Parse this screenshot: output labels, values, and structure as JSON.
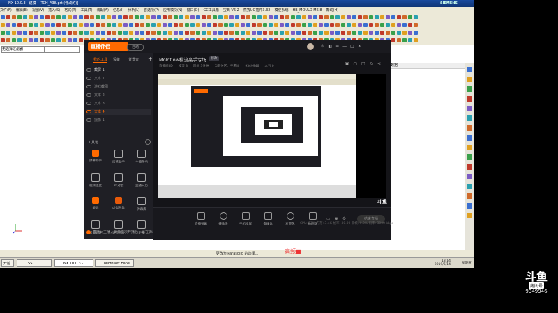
{
  "nx": {
    "title": "NX 10.0.3 - 建模 - [TCH_A38.prt (修改的)]",
    "brand": "SIEMENS",
    "menu": [
      "文件(F)",
      "编辑(E)",
      "视图(V)",
      "插入(S)",
      "格式(R)",
      "工具(T)",
      "装配(A)",
      "信息(I)",
      "分析(L)",
      "首选项(P)",
      "应用模块(N)",
      "窗口(O)",
      "GC工具箱",
      "宝典 V6.2",
      "燕秀UG插件3.32",
      "模胚系统",
      "HB_MOULD M6.8",
      "帮助(H)"
    ],
    "combo_value": "无选择过滤器",
    "right_header": "数据",
    "status_text": "更改为 Parasolid 的选择...",
    "taskbar": [
      "开始",
      "TSS",
      "NX 10.0.3 - ...",
      "Microsoft Excel"
    ],
    "clock": "13:14",
    "date": "2019/6/14",
    "tray_text": "星期五"
  },
  "douyu": {
    "logo": "直播伴侣",
    "logo_tag": "自动",
    "tabs": [
      "场景 1",
      "场景 2",
      "场景 3"
    ],
    "left_tabs": [
      "我的工具",
      "设备",
      "背景音"
    ],
    "scenes": [
      "截屏 1",
      "文本 1",
      "游戏截图",
      "文本 2",
      "文本 3",
      "文本 4",
      "摄像 1"
    ],
    "tools_header": "工具箱",
    "tools": [
      "弹幕助手",
      "房管助手",
      "主播任务",
      "视频连麦",
      "PK对战",
      "主播日历",
      "录屏",
      "虚拟形象",
      "弹幕库",
      "智能标注",
      "语音连麦",
      "更多"
    ],
    "notice": "直播间主播，每日首次开播后，请在弹幕栏进行互动",
    "room_title": "Moldflow模流高手专场",
    "room_badge": "修改",
    "room_sub": [
      "直播间 ID",
      "模流 3",
      "时间 3分钟",
      "当前分区：手游加",
      "9349946",
      "人气 0"
    ],
    "controls": [
      "直播弹幕",
      "摄像头",
      "手机投屏",
      "多媒体",
      "麦克风",
      "扬声器"
    ],
    "go_live": "结束直播",
    "stats": "CPU: 23%   内存: 3.4G   帧率: 30.00   丢帧: 0.0%   码率: 3000 kbps"
  },
  "overlay": {
    "watermark_brand": "斗鱼",
    "watermark_room_label": "房间号",
    "watermark_room": "9349946",
    "red_text": "高频■"
  },
  "colors": {
    "douyu_orange": "#ff6a00",
    "nx_title": "#1a4a9e"
  }
}
